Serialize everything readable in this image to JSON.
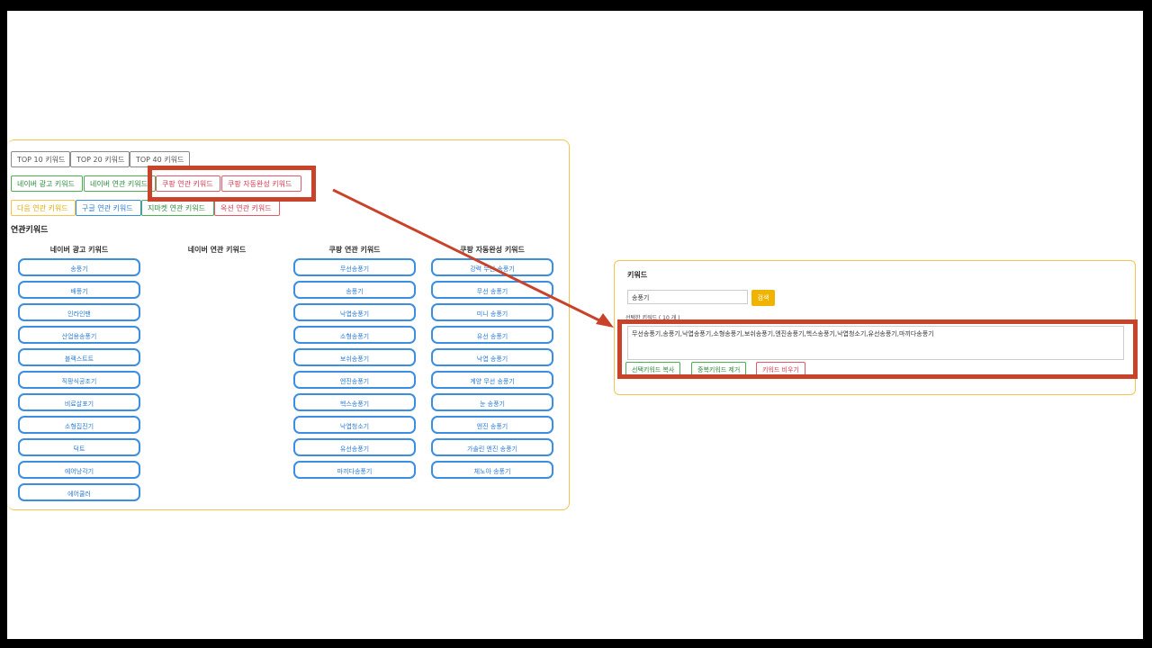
{
  "tabs_top": [
    "TOP 10 키워드",
    "TOP 20 키워드",
    "TOP 40 키워드"
  ],
  "tabs_row2": [
    {
      "label": "네이버 광고 키워드",
      "color": "green"
    },
    {
      "label": "네이버 연관 키워드",
      "color": "green"
    },
    {
      "label": "쿠팡 연관 키워드",
      "color": "red"
    },
    {
      "label": "쿠팡 자동완성 키워드",
      "color": "red"
    }
  ],
  "tabs_row3": [
    {
      "label": "다음 연관 키워드",
      "color": "yellow"
    },
    {
      "label": "구글 연관 키워드",
      "color": "blue"
    },
    {
      "label": "지마켓 연관 키워드",
      "color": "green"
    },
    {
      "label": "옥션 연관 키워드",
      "color": "red"
    }
  ],
  "section_title": "연관키워드",
  "columns": [
    {
      "header": "네이버 광고 키워드",
      "items": [
        "송풍기",
        "배풍기",
        "인라인팬",
        "산업용송풍기",
        "블랙스트트",
        "직팡식공조기",
        "비료살포기",
        "소형집진기",
        "덕트",
        "에어낭각기",
        "에어쿨러"
      ]
    },
    {
      "header": "네이버 연관 키워드",
      "items": []
    },
    {
      "header": "쿠팡 연관 키워드",
      "items": [
        "무선송풍기",
        "송풍기",
        "낙엽송풍기",
        "소형송풍기",
        "보쉬송풍기",
        "엔진송풍기",
        "헥스송풍기",
        "낙엽청소기",
        "유선송풍기",
        "마끼다송풍기"
      ]
    },
    {
      "header": "쿠팡 자동완성 키워드",
      "items": [
        "강력 무선 송풍기",
        "무선 송풍기",
        "미니 송풍기",
        "유선 송풍기",
        "낙엽 송풍기",
        "계양 무선 송풍기",
        "눈 송풍기",
        "엔진 송풍기",
        "가솔린 엔진 송풍기",
        "체노아 송풍기"
      ]
    }
  ],
  "right_panel": {
    "title": "키워드",
    "input_value": "송풍기",
    "search_label": "검색",
    "selected_label": "선택한 키워드 ( 10 개 )",
    "selected_value": "무선송풍기,송풍기,낙엽송풍기,소형송풍기,보쉬송풍기,엔진송풍기,헥스송풍기,낙엽청소기,유선송풍기,마끼다송풍기",
    "btn_copy": "선택키워드 복사",
    "btn_dedupe": "중복키워드 제거",
    "btn_clear": "키워드 비우기"
  },
  "colors": {
    "annotation": "#c8432a",
    "panel_border": "#f3c44f",
    "pill_border": "#3b8ee0",
    "search_button": "#f0b400"
  }
}
